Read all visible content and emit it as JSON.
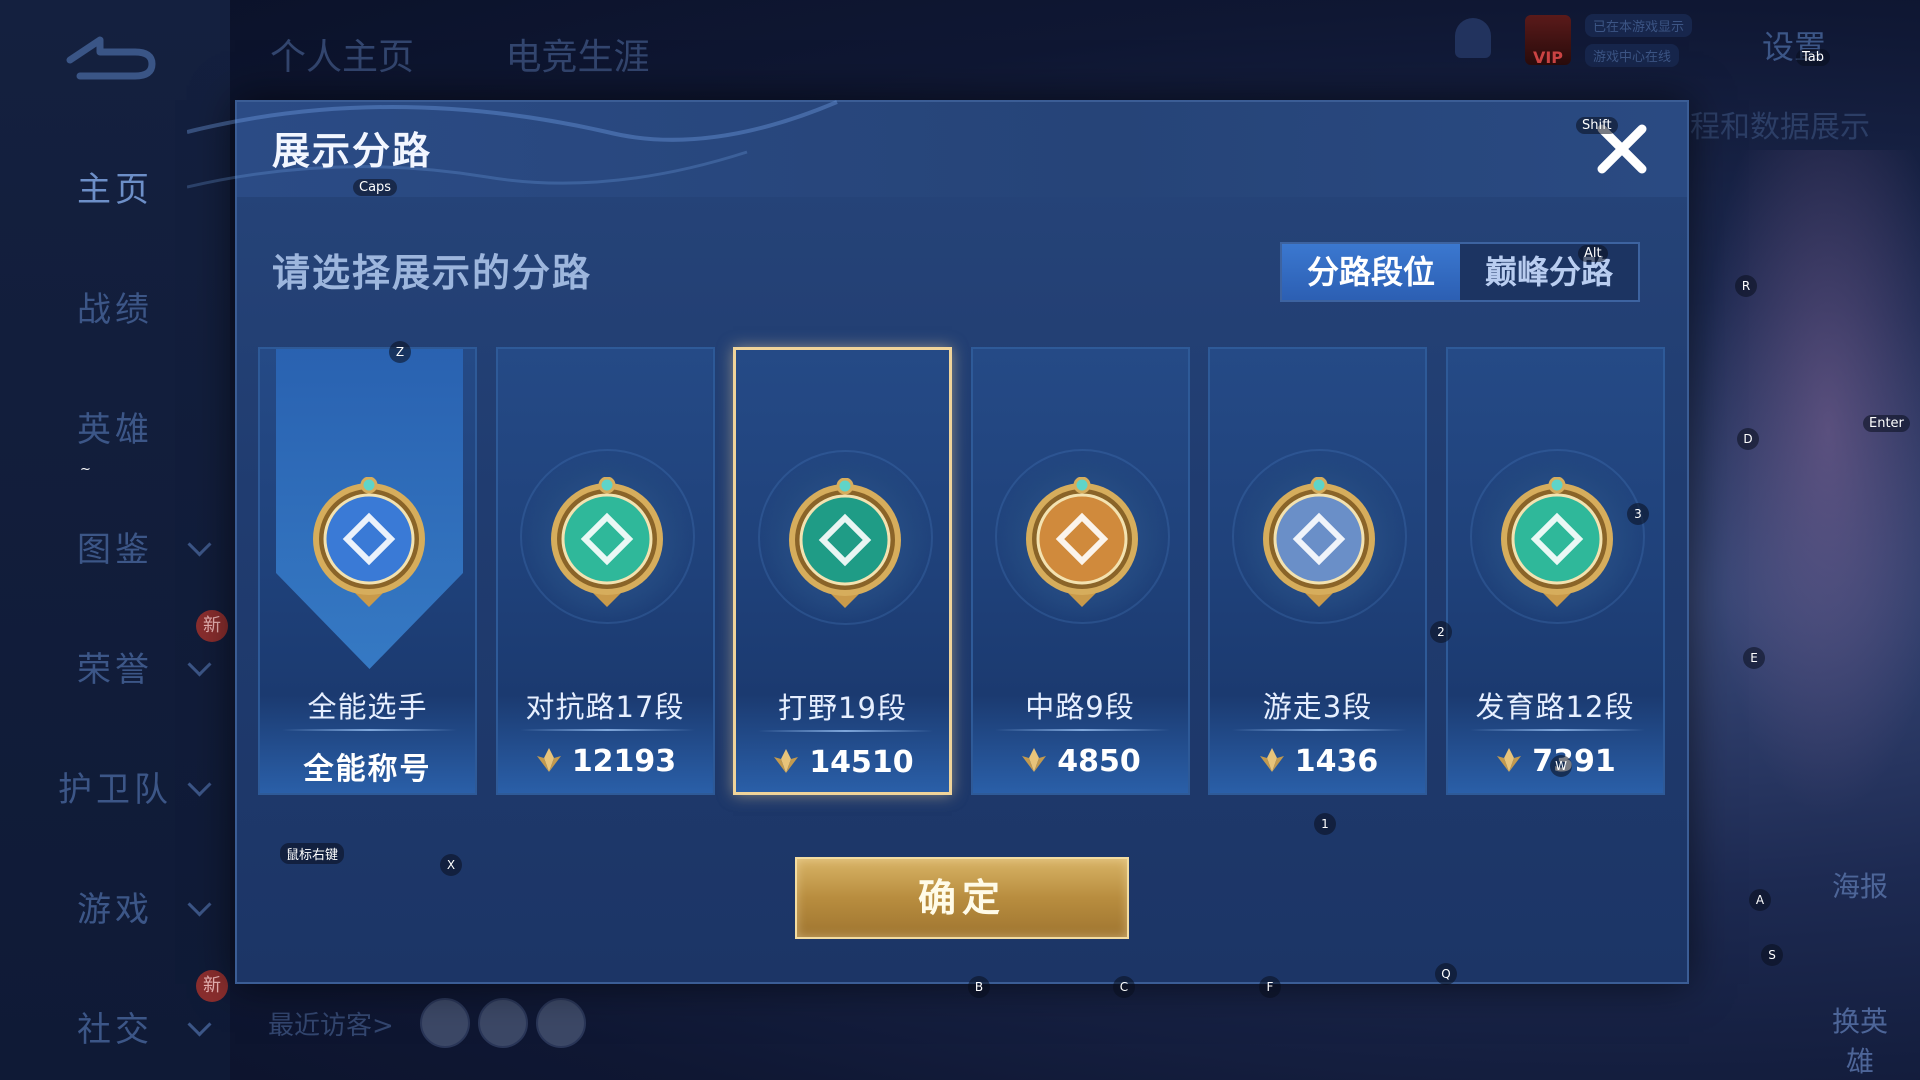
{
  "background": {
    "left_nav": [
      {
        "label": "主页",
        "active": true
      },
      {
        "label": "战绩"
      },
      {
        "label": "英雄"
      },
      {
        "label": "图鉴",
        "dropdown": true
      },
      {
        "label": "荣誉",
        "dropdown": true,
        "badge": "新"
      },
      {
        "label": "护卫队",
        "dropdown": true
      },
      {
        "label": "游戏",
        "dropdown": true
      },
      {
        "label": "社交",
        "dropdown": true,
        "badge": "新"
      }
    ],
    "top_tabs": [
      "个人主页",
      "电竞生涯"
    ],
    "vip_label": "VIP",
    "status_lines": [
      "已在本游戏显示",
      "游戏中心在线"
    ],
    "settings_label": "设置",
    "side_text": "程和数据展示",
    "right_buttons": [
      "海报",
      "换英雄"
    ],
    "visitors_label": "最近访客>"
  },
  "dialog": {
    "title": "展示分路",
    "subtitle": "请选择展示的分路",
    "toggle": {
      "options": [
        "分路段位",
        "巅峰分路"
      ],
      "selected": 0
    },
    "cards": [
      {
        "name": "全能选手",
        "sub": "全能称号",
        "type": "title",
        "emblem": "allround-emblem",
        "color": "#3a7ad6"
      },
      {
        "name": "对抗路17段",
        "score": "12193",
        "type": "score",
        "emblem": "clash-lane-emblem",
        "color": "#2fb89a"
      },
      {
        "name": "打野19段",
        "score": "14510",
        "type": "score",
        "emblem": "jungle-emblem",
        "color": "#1f9c86",
        "selected": true
      },
      {
        "name": "中路9段",
        "score": "4850",
        "type": "score",
        "emblem": "mid-lane-emblem",
        "color": "#d08a3c"
      },
      {
        "name": "游走3段",
        "score": "1436",
        "type": "score",
        "emblem": "roam-emblem",
        "color": "#6a8fc8"
      },
      {
        "name": "发育路12段",
        "score": "7391",
        "type": "score",
        "emblem": "farm-lane-emblem",
        "color": "#2fb89a"
      }
    ],
    "confirm_label": "确定"
  },
  "key_hints": {
    "caps": "Caps",
    "shift": "Shift",
    "tab": "Tab",
    "alt": "Alt",
    "enter": "Enter",
    "right_click": "鼠标右键",
    "z": "Z",
    "x": "X",
    "r": "R",
    "d": "D",
    "e": "E",
    "a": "A",
    "s": "S",
    "q": "Q",
    "w": "W",
    "b": "B",
    "c": "C",
    "f": "F",
    "n1": "1",
    "n2": "2",
    "n3": "3",
    "tilde": "~"
  }
}
